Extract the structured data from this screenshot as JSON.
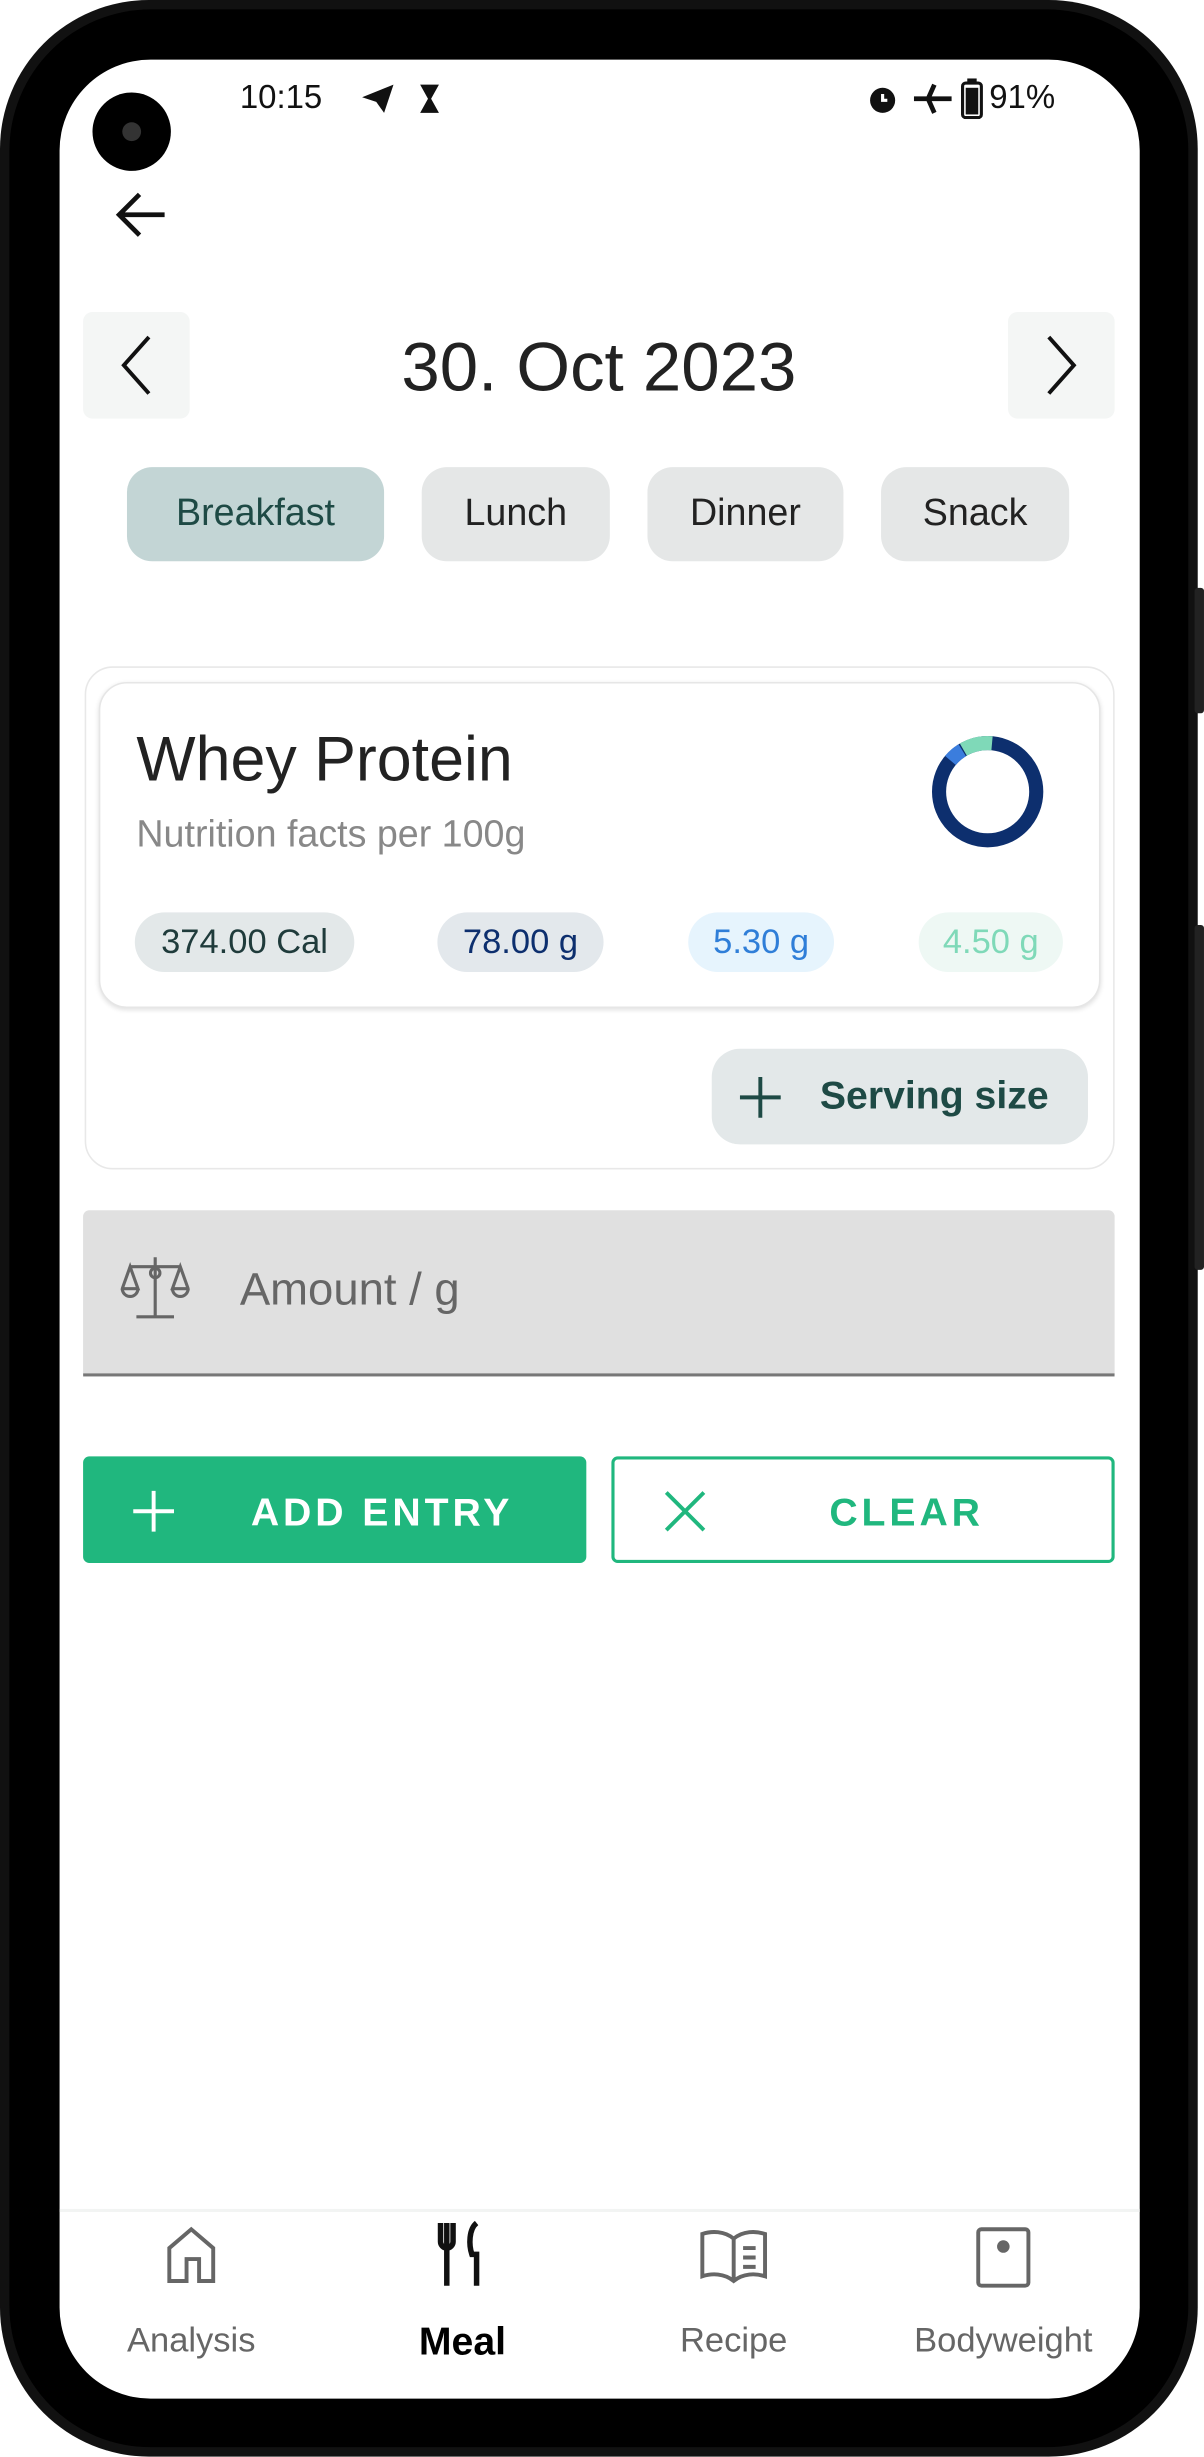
{
  "status_bar": {
    "time": "10:15",
    "battery": "91%",
    "icons": [
      "telegram-icon",
      "hourglass-icon",
      "alarm-icon",
      "airplane-icon",
      "battery-icon"
    ]
  },
  "header": {
    "back_icon": "arrow-left-icon"
  },
  "date_nav": {
    "date": "30. Oct 2023",
    "prev_icon": "chevron-left-icon",
    "next_icon": "chevron-right-icon"
  },
  "meal_tabs": [
    {
      "label": "Breakfast",
      "selected": true
    },
    {
      "label": "Lunch",
      "selected": false
    },
    {
      "label": "Dinner",
      "selected": false
    },
    {
      "label": "Snack",
      "selected": false
    }
  ],
  "food": {
    "name": "Whey Protein",
    "subtitle": "Nutrition facts per 100g",
    "calories": "374.00 Cal",
    "macros": [
      {
        "value": "78.00 g",
        "color": "#0d2f6e"
      },
      {
        "value": "5.30 g",
        "color": "#2f7ed8"
      },
      {
        "value": "4.50 g",
        "color": "#7fd9b8"
      }
    ],
    "serving_button": "Serving size"
  },
  "amount_field": {
    "placeholder": "Amount / g",
    "value": "",
    "icon": "scale-icon"
  },
  "actions": {
    "add": "ADD ENTRY",
    "clear": "CLEAR"
  },
  "colors": {
    "accent": "#20b77e",
    "selected_chip": "#c3d5d5"
  },
  "bottom_nav": [
    {
      "label": "Analysis",
      "icon": "home-icon",
      "active": false
    },
    {
      "label": "Meal",
      "icon": "fork-knife-icon",
      "active": true
    },
    {
      "label": "Recipe",
      "icon": "book-icon",
      "active": false
    },
    {
      "label": "Bodyweight",
      "icon": "scale-device-icon",
      "active": false
    }
  ]
}
